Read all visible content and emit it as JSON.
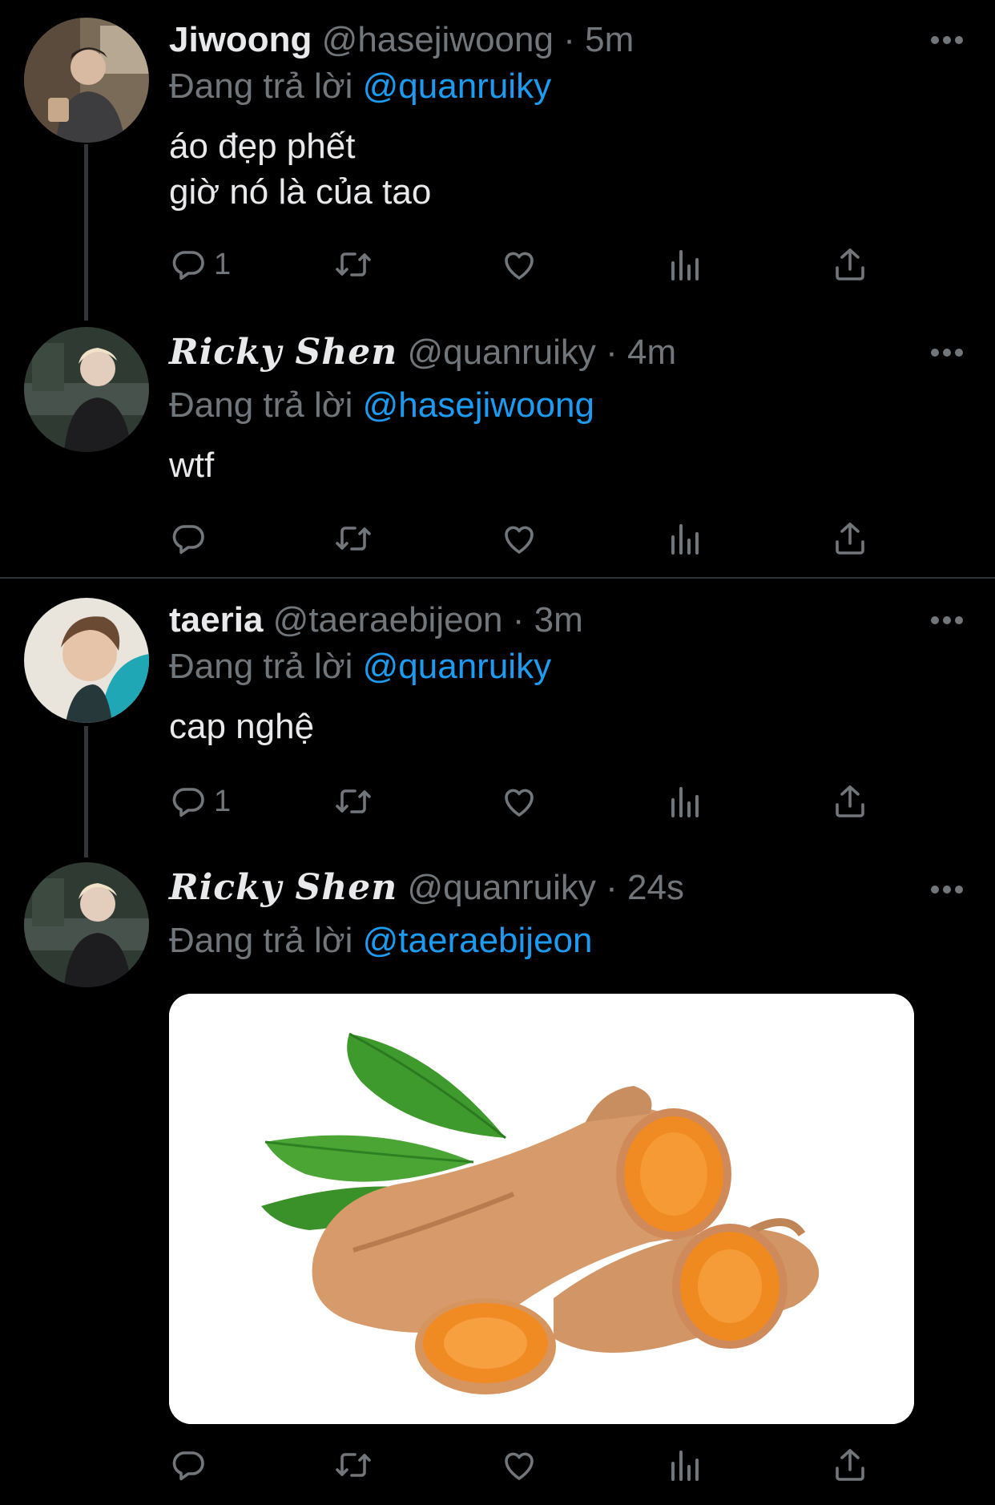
{
  "tweets": [
    {
      "name": "Jiwoong",
      "handle": "@hasejiwoong",
      "separator": "·",
      "time": "5m",
      "replying_prefix": "Đang trả lời",
      "replying_to": "@quanruiky",
      "text_lines": [
        "áo đẹp phết",
        "giờ nó là của tao"
      ],
      "reply_count": "1"
    },
    {
      "name": "Ricky Shen",
      "handle": "@quanruiky",
      "separator": "·",
      "time": "4m",
      "replying_prefix": "Đang trả lời",
      "replying_to": "@hasejiwoong",
      "text_lines": [
        "wtf"
      ],
      "reply_count": ""
    },
    {
      "name": "taeria",
      "handle": "@taeraebijeon",
      "separator": "·",
      "time": "3m",
      "replying_prefix": "Đang trả lời",
      "replying_to": "@quanruiky",
      "text_lines": [
        "cap nghệ"
      ],
      "reply_count": "1"
    },
    {
      "name": "Ricky Shen",
      "handle": "@quanruiky",
      "separator": "·",
      "time": "24s",
      "replying_prefix": "Đang trả lời",
      "replying_to": "@taeraebijeon",
      "text_lines": [],
      "reply_count": "",
      "media": "turmeric-photo"
    }
  ],
  "colors": {
    "background": "#000000",
    "text": "#e7e9ea",
    "muted": "#71767b",
    "mention": "#1d9bf0",
    "divider": "#2f3336"
  },
  "icons": [
    "reply-icon",
    "retweet-icon",
    "like-icon",
    "views-icon",
    "share-icon",
    "more-icon"
  ]
}
